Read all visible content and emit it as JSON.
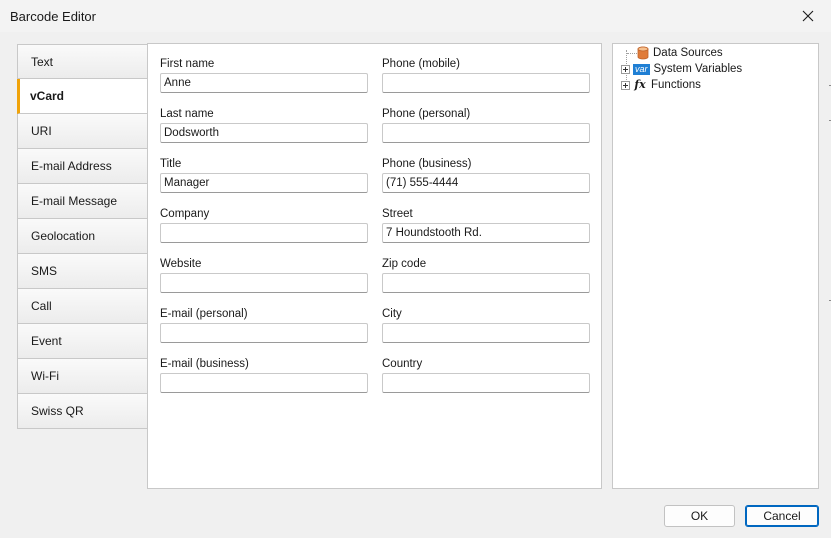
{
  "window": {
    "title": "Barcode Editor"
  },
  "tabs": [
    {
      "label": "Text"
    },
    {
      "label": "vCard"
    },
    {
      "label": "URI"
    },
    {
      "label": "E-mail Address"
    },
    {
      "label": "E-mail Message"
    },
    {
      "label": "Geolocation"
    },
    {
      "label": "SMS"
    },
    {
      "label": "Call"
    },
    {
      "label": "Event"
    },
    {
      "label": "Wi-Fi"
    },
    {
      "label": "Swiss QR"
    }
  ],
  "active_tab": "vCard",
  "form": {
    "first_name": {
      "label": "First name",
      "value": "Anne"
    },
    "last_name": {
      "label": "Last name",
      "value": "Dodsworth"
    },
    "title": {
      "label": "Title",
      "value": "Manager"
    },
    "company": {
      "label": "Company",
      "value": ""
    },
    "website": {
      "label": "Website",
      "value": ""
    },
    "email_personal": {
      "label": "E-mail (personal)",
      "value": ""
    },
    "email_business": {
      "label": "E-mail (business)",
      "value": ""
    },
    "phone_mobile": {
      "label": "Phone (mobile)",
      "value": ""
    },
    "phone_personal": {
      "label": "Phone (personal)",
      "value": ""
    },
    "phone_business": {
      "label": "Phone (business)",
      "value": "(71) 555-4444"
    },
    "street": {
      "label": "Street",
      "value": "7 Houndstooth Rd."
    },
    "zip_code": {
      "label": "Zip code",
      "value": ""
    },
    "city": {
      "label": "City",
      "value": ""
    },
    "country": {
      "label": "Country",
      "value": ""
    }
  },
  "tree": {
    "data_sources": {
      "label": "Data Sources",
      "icon": "database-icon"
    },
    "system_variables": {
      "label": "System Variables",
      "icon": "var-icon",
      "icon_text": "var"
    },
    "functions": {
      "label": "Functions",
      "icon": "fx-icon",
      "icon_text": "fx"
    }
  },
  "buttons": {
    "ok": "OK",
    "cancel": "Cancel"
  },
  "colors": {
    "active_tab_accent": "#f0a30a",
    "default_button_border": "#0067c0",
    "var_icon_bg": "#1f7fd4"
  }
}
